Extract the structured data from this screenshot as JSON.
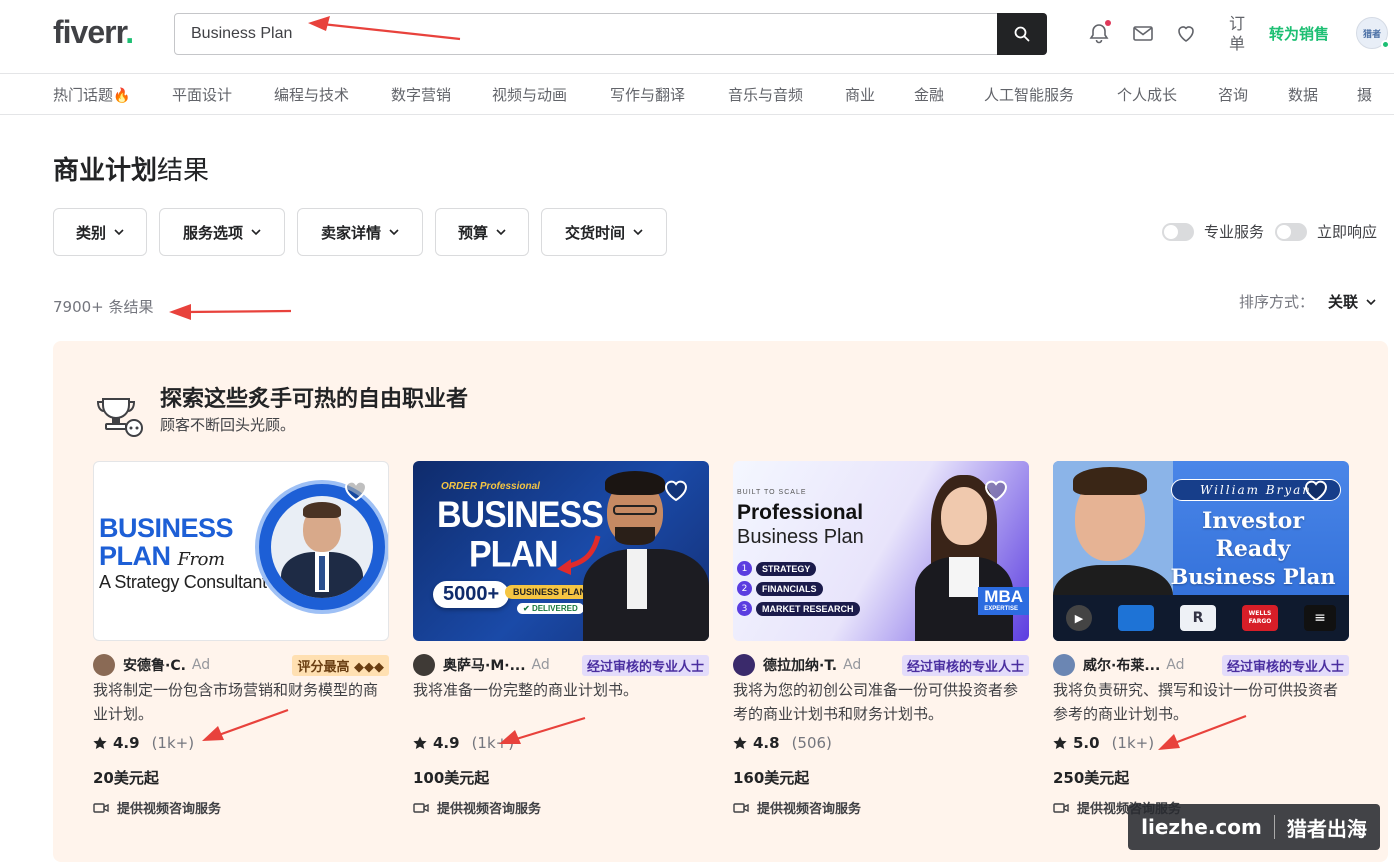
{
  "header": {
    "logo_text": "fiverr",
    "logo_dot": ".",
    "search_value": "Business Plan",
    "orders_label": "订单",
    "become_seller_label": "转为销售",
    "avatar_text": "猎者"
  },
  "categories": [
    "热门话题",
    "平面设计",
    "编程与技术",
    "数字营销",
    "视频与动画",
    "写作与翻译",
    "音乐与音频",
    "商业",
    "金融",
    "人工智能服务",
    "个人成长",
    "咨询",
    "数据",
    "摄"
  ],
  "page": {
    "title_bold": "商业计划",
    "title_rest": "结果",
    "result_count": "7900+ 条结果",
    "sort_label": "排序方式：",
    "sort_value": "关联"
  },
  "filters": [
    "类别",
    "服务选项",
    "卖家详情",
    "预算",
    "交货时间"
  ],
  "toggles": [
    "专业服务",
    "立即响应"
  ],
  "featured": {
    "title": "探索这些炙手可热的自由职业者",
    "subtitle": "顾客不断回头光顾。",
    "cards": [
      {
        "seller": "安德鲁·C.",
        "ad": "Ad",
        "badge": "评分最高 ◆◆◆",
        "badge_type": "top",
        "description": "我将制定一份包含市场营销和财务模型的商业计划。",
        "score": "4.9",
        "reviews": "(1k+)",
        "price": "20美元起",
        "consult": "提供视频咨询服务",
        "thumb": {
          "line1": "BUSINESS",
          "line2": "PLAN",
          "script": "From",
          "line3": "A Strategy Consultant"
        }
      },
      {
        "seller": "奥萨马·M·...",
        "ad": "Ad",
        "badge": "经过审核的专业人士",
        "badge_type": "pro",
        "description": "我将准备一份完整的商业计划书。",
        "score": "4.9",
        "reviews": "(1k+)",
        "price": "100美元起",
        "consult": "提供视频咨询服务",
        "thumb": {
          "top": "ORDER Professional",
          "line1": "BUSINESS",
          "line2": "PLAN",
          "count": "5000+",
          "tag": "BUSINESS PLANS",
          "delivered": "DELIVERED"
        }
      },
      {
        "seller": "德拉加纳·T.",
        "ad": "Ad",
        "badge": "经过审核的专业人士",
        "badge_type": "pro",
        "description": "我将为您的初创公司准备一份可供投资者参考的商业计划书和财务计划书。",
        "score": "4.8",
        "reviews": "(506)",
        "price": "160美元起",
        "consult": "提供视频咨询服务",
        "thumb": {
          "top": "BUILT TO SCALE",
          "line1": "Professional",
          "line2": "Business Plan",
          "items": [
            "STRATEGY",
            "FINANCIALS",
            "MARKET RESEARCH"
          ],
          "mba": "MBA",
          "mba_sub": "EXPERTISE"
        }
      },
      {
        "seller": "威尔·布莱...",
        "ad": "Ad",
        "badge": "经过审核的专业人士",
        "badge_type": "pro",
        "description": "我将负责研究、撰写和设计一份可供投资者参考的商业计划书。",
        "score": "5.0",
        "reviews": "(1k+)",
        "price": "250美元起",
        "consult": "提供视频咨询服务",
        "thumb": {
          "name": "William Bryan",
          "line1": "Investor",
          "line2": "Ready",
          "line3": "Business Plan",
          "logo_wf": "WELLS FARGO"
        }
      }
    ]
  },
  "watermark": {
    "left": "liezhe.com",
    "right": "猎者出海"
  },
  "colors": {
    "brand_green": "#1dbf73",
    "annotation_red": "#e8423c",
    "featured_bg": "#fff4ec"
  }
}
